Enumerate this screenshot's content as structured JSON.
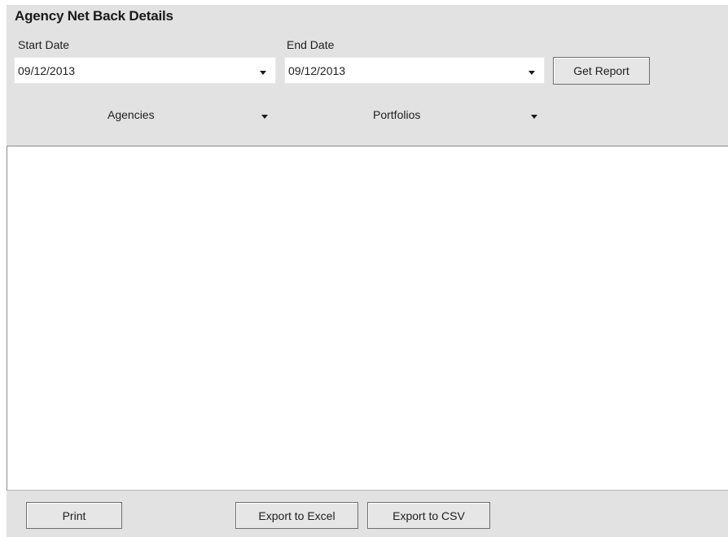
{
  "title": "Agency Net Back Details",
  "start_date": {
    "label": "Start Date",
    "value": "09/12/2013"
  },
  "end_date": {
    "label": "End Date",
    "value": "09/12/2013"
  },
  "get_report_label": "Get Report",
  "filters": {
    "agencies": "Agencies",
    "portfolios": "Portfolios"
  },
  "footer": {
    "print": "Print",
    "export_excel": "Export to Excel",
    "export_csv": "Export to CSV"
  },
  "icons": {
    "dropdown": "chevron-down-icon"
  }
}
